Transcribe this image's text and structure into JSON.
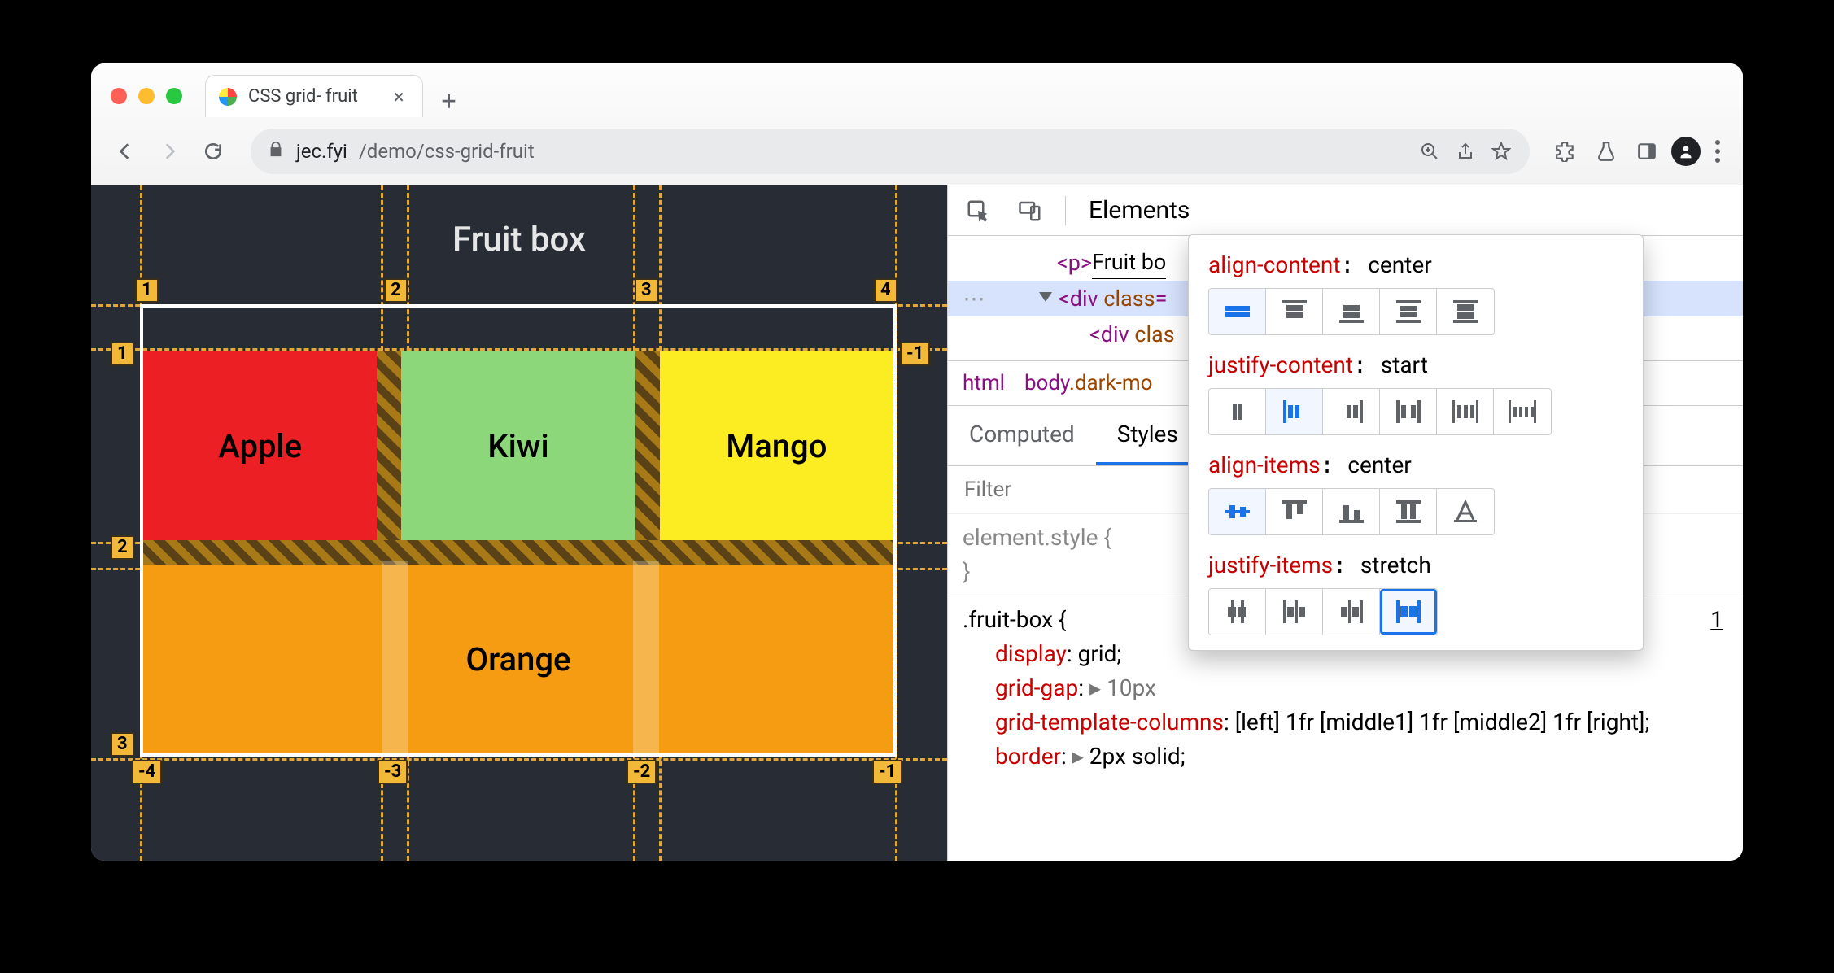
{
  "browser": {
    "tab_title": "CSS grid- fruit",
    "url_host": "jec.fyi",
    "url_path": "/demo/css-grid-fruit"
  },
  "page": {
    "title": "Fruit box",
    "items": [
      "Apple",
      "Kiwi",
      "Mango",
      "Orange"
    ],
    "grid_top_numbers": [
      "1",
      "2",
      "3",
      "4"
    ],
    "grid_left_numbers": [
      "1",
      "2",
      "3"
    ],
    "grid_right_numbers": [
      "-1"
    ],
    "grid_bottom_numbers": [
      "-4",
      "-3",
      "-2",
      "-1"
    ]
  },
  "devtools": {
    "main_tab": "Elements",
    "dom": {
      "line1_text": "Fruit bo",
      "line1_tag_open": "<p>",
      "line2": "<div class=",
      "line3": "<div clas"
    },
    "crumbs": {
      "root": "html",
      "body": "body",
      "body_class": ".dark-mo"
    },
    "subtabs": [
      "Computed",
      "Styles"
    ],
    "filter_placeholder": "Filter",
    "style_block1": "element.style {",
    "style_block1_close": "}",
    "style_selector": ".fruit-box {",
    "decls": [
      {
        "prop": "display",
        "val": "grid"
      },
      {
        "prop": "grid-gap",
        "val": "10px",
        "disclose": true
      },
      {
        "prop": "grid-template-columns",
        "val": "[left] 1fr [middle1] 1fr [middle2] 1fr [right]"
      },
      {
        "prop": "border",
        "val": "2px solid",
        "disclose": true
      }
    ],
    "link_text": "1"
  },
  "popover": {
    "rows": [
      {
        "prop": "align-content",
        "val": "center"
      },
      {
        "prop": "justify-content",
        "val": "start"
      },
      {
        "prop": "align-items",
        "val": "center"
      },
      {
        "prop": "justify-items",
        "val": "stretch"
      }
    ]
  }
}
